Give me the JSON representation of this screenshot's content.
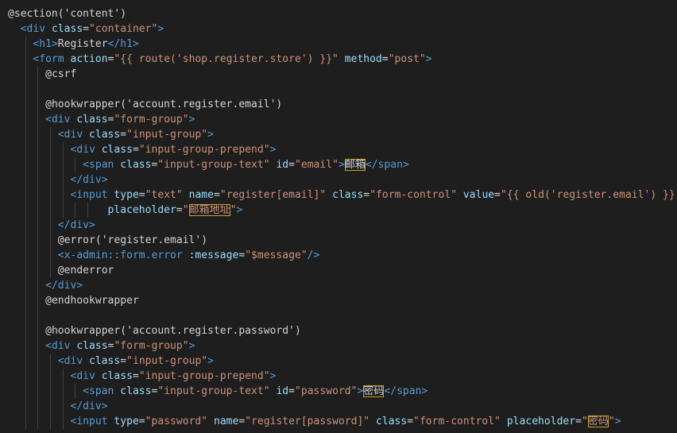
{
  "editor": {
    "language": "blade",
    "colors": {
      "background": "#1e1e1e",
      "tag": "#569cd6",
      "attribute": "#9cdcfe",
      "string": "#ce9178",
      "text": "#d4d4d4",
      "highlight_border": "#c8a227"
    },
    "lines": [
      {
        "indent": 0,
        "tokens": [
          {
            "t": "@section('content')",
            "c": "dir"
          }
        ]
      },
      {
        "indent": 1,
        "tokens": [
          {
            "t": "<div",
            "c": "tag"
          },
          {
            "t": " class",
            "c": "attr"
          },
          {
            "t": "=",
            "c": "text"
          },
          {
            "t": "\"container\"",
            "c": "str"
          },
          {
            "t": ">",
            "c": "tag"
          }
        ]
      },
      {
        "indent": 2,
        "tokens": [
          {
            "t": "<h1>",
            "c": "tag"
          },
          {
            "t": "Register",
            "c": "text"
          },
          {
            "t": "</h1>",
            "c": "tag"
          }
        ]
      },
      {
        "indent": 2,
        "tokens": [
          {
            "t": "<form",
            "c": "tag"
          },
          {
            "t": " action",
            "c": "attr"
          },
          {
            "t": "=",
            "c": "text"
          },
          {
            "t": "\"{{ route('shop.register.store') }}\"",
            "c": "str"
          },
          {
            "t": " method",
            "c": "attr"
          },
          {
            "t": "=",
            "c": "text"
          },
          {
            "t": "\"post\"",
            "c": "str"
          },
          {
            "t": ">",
            "c": "tag"
          }
        ]
      },
      {
        "indent": 3,
        "tokens": [
          {
            "t": "@csrf",
            "c": "dir"
          }
        ]
      },
      {
        "indent": 3,
        "tokens": []
      },
      {
        "indent": 3,
        "tokens": [
          {
            "t": "@hookwrapper('account.register.email')",
            "c": "dir"
          }
        ]
      },
      {
        "indent": 3,
        "tokens": [
          {
            "t": "<div",
            "c": "tag"
          },
          {
            "t": " class",
            "c": "attr"
          },
          {
            "t": "=",
            "c": "text"
          },
          {
            "t": "\"form-group\"",
            "c": "str"
          },
          {
            "t": ">",
            "c": "tag"
          }
        ]
      },
      {
        "indent": 4,
        "tokens": [
          {
            "t": "<div",
            "c": "tag"
          },
          {
            "t": " class",
            "c": "attr"
          },
          {
            "t": "=",
            "c": "text"
          },
          {
            "t": "\"input-group\"",
            "c": "str"
          },
          {
            "t": ">",
            "c": "tag"
          }
        ]
      },
      {
        "indent": 5,
        "tokens": [
          {
            "t": "<div",
            "c": "tag"
          },
          {
            "t": " class",
            "c": "attr"
          },
          {
            "t": "=",
            "c": "text"
          },
          {
            "t": "\"input-group-prepend\"",
            "c": "str"
          },
          {
            "t": ">",
            "c": "tag"
          }
        ]
      },
      {
        "indent": 6,
        "tokens": [
          {
            "t": "<span",
            "c": "tag"
          },
          {
            "t": " class",
            "c": "attr"
          },
          {
            "t": "=",
            "c": "text"
          },
          {
            "t": "\"input-group-text\"",
            "c": "str"
          },
          {
            "t": " id",
            "c": "attr"
          },
          {
            "t": "=",
            "c": "text"
          },
          {
            "t": "\"email\"",
            "c": "str"
          },
          {
            "t": ">",
            "c": "tag"
          },
          {
            "t": "邮箱",
            "c": "text",
            "hl": true
          },
          {
            "t": "</span>",
            "c": "tag"
          }
        ]
      },
      {
        "indent": 5,
        "tokens": [
          {
            "t": "</div>",
            "c": "tag"
          }
        ]
      },
      {
        "indent": 5,
        "tokens": [
          {
            "t": "<input",
            "c": "tag"
          },
          {
            "t": " type",
            "c": "attr"
          },
          {
            "t": "=",
            "c": "text"
          },
          {
            "t": "\"text\"",
            "c": "str"
          },
          {
            "t": " name",
            "c": "attr"
          },
          {
            "t": "=",
            "c": "text"
          },
          {
            "t": "\"register[email]\"",
            "c": "str"
          },
          {
            "t": " class",
            "c": "attr"
          },
          {
            "t": "=",
            "c": "text"
          },
          {
            "t": "\"form-control\"",
            "c": "str"
          },
          {
            "t": " value",
            "c": "attr"
          },
          {
            "t": "=",
            "c": "text"
          },
          {
            "t": "\"{{ old('register.email') }}\"",
            "c": "str"
          }
        ]
      },
      {
        "indent": 8,
        "tokens": [
          {
            "t": "placeholder",
            "c": "attr"
          },
          {
            "t": "=",
            "c": "text"
          },
          {
            "t": "\"",
            "c": "str"
          },
          {
            "t": "邮箱地址",
            "c": "str",
            "hl": true
          },
          {
            "t": "\"",
            "c": "str"
          },
          {
            "t": ">",
            "c": "tag"
          }
        ]
      },
      {
        "indent": 4,
        "tokens": [
          {
            "t": "</div>",
            "c": "tag"
          }
        ]
      },
      {
        "indent": 4,
        "tokens": [
          {
            "t": "@error('register.email')",
            "c": "dir"
          }
        ]
      },
      {
        "indent": 4,
        "tokens": [
          {
            "t": "<x-admin::form.error",
            "c": "tag"
          },
          {
            "t": " :message",
            "c": "attr"
          },
          {
            "t": "=",
            "c": "text"
          },
          {
            "t": "\"$message\"",
            "c": "str"
          },
          {
            "t": "/>",
            "c": "tag"
          }
        ]
      },
      {
        "indent": 4,
        "tokens": [
          {
            "t": "@enderror",
            "c": "dir"
          }
        ]
      },
      {
        "indent": 3,
        "tokens": [
          {
            "t": "</div>",
            "c": "tag"
          }
        ]
      },
      {
        "indent": 3,
        "tokens": [
          {
            "t": "@endhookwrapper",
            "c": "dir"
          }
        ]
      },
      {
        "indent": 3,
        "tokens": []
      },
      {
        "indent": 3,
        "tokens": [
          {
            "t": "@hookwrapper('account.register.password')",
            "c": "dir"
          }
        ]
      },
      {
        "indent": 3,
        "tokens": [
          {
            "t": "<div",
            "c": "tag"
          },
          {
            "t": " class",
            "c": "attr"
          },
          {
            "t": "=",
            "c": "text"
          },
          {
            "t": "\"form-group\"",
            "c": "str"
          },
          {
            "t": ">",
            "c": "tag"
          }
        ]
      },
      {
        "indent": 4,
        "tokens": [
          {
            "t": "<div",
            "c": "tag"
          },
          {
            "t": " class",
            "c": "attr"
          },
          {
            "t": "=",
            "c": "text"
          },
          {
            "t": "\"input-group\"",
            "c": "str"
          },
          {
            "t": ">",
            "c": "tag"
          }
        ]
      },
      {
        "indent": 5,
        "tokens": [
          {
            "t": "<div",
            "c": "tag"
          },
          {
            "t": " class",
            "c": "attr"
          },
          {
            "t": "=",
            "c": "text"
          },
          {
            "t": "\"input-group-prepend\"",
            "c": "str"
          },
          {
            "t": ">",
            "c": "tag"
          }
        ]
      },
      {
        "indent": 6,
        "tokens": [
          {
            "t": "<span",
            "c": "tag"
          },
          {
            "t": " class",
            "c": "attr"
          },
          {
            "t": "=",
            "c": "text"
          },
          {
            "t": "\"input-group-text\"",
            "c": "str"
          },
          {
            "t": " id",
            "c": "attr"
          },
          {
            "t": "=",
            "c": "text"
          },
          {
            "t": "\"password\"",
            "c": "str"
          },
          {
            "t": ">",
            "c": "tag"
          },
          {
            "t": "密码",
            "c": "text",
            "hl": true
          },
          {
            "t": "</span>",
            "c": "tag"
          }
        ]
      },
      {
        "indent": 5,
        "tokens": [
          {
            "t": "</div>",
            "c": "tag"
          }
        ]
      },
      {
        "indent": 5,
        "tokens": [
          {
            "t": "<input",
            "c": "tag"
          },
          {
            "t": " type",
            "c": "attr"
          },
          {
            "t": "=",
            "c": "text"
          },
          {
            "t": "\"password\"",
            "c": "str"
          },
          {
            "t": " name",
            "c": "attr"
          },
          {
            "t": "=",
            "c": "text"
          },
          {
            "t": "\"register[password]\"",
            "c": "str"
          },
          {
            "t": " class",
            "c": "attr"
          },
          {
            "t": "=",
            "c": "text"
          },
          {
            "t": "\"form-control\"",
            "c": "str"
          },
          {
            "t": " placeholder",
            "c": "attr"
          },
          {
            "t": "=",
            "c": "text"
          },
          {
            "t": "\"",
            "c": "str"
          },
          {
            "t": "密码",
            "c": "str",
            "hl": true
          },
          {
            "t": "\"",
            "c": "str"
          },
          {
            "t": ">",
            "c": "tag"
          }
        ]
      }
    ]
  }
}
